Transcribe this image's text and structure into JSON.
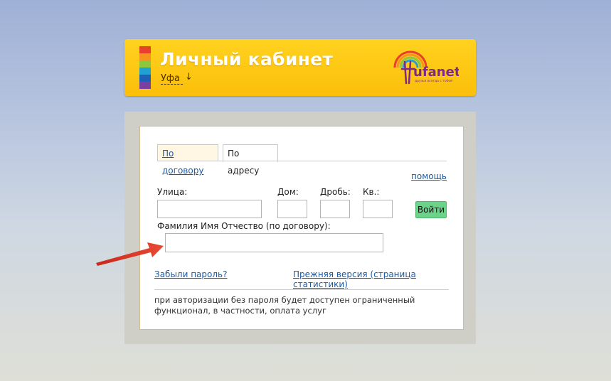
{
  "header": {
    "title": "Личный кабинет",
    "city": "Уфа",
    "city_icon": "arrow-down-icon",
    "logo_text": "ufanet",
    "logo_tagline": "друзья всегда с тобой",
    "stripe_colors": [
      "#e8402a",
      "#f7941d",
      "#8dc63f",
      "#21a0d2",
      "#1e5fb8",
      "#7b3fa0"
    ]
  },
  "tabs": [
    {
      "label": "По договору",
      "active": false
    },
    {
      "label": "По адресу",
      "active": true
    }
  ],
  "help_link": "помощь",
  "form": {
    "street_label": "Улица:",
    "house_label": "Дом:",
    "fraction_label": "Дробь:",
    "apartment_label": "Кв.:",
    "submit_label": "Войти",
    "name_label": "Фамилия Имя Отчество (по договору):",
    "street_value": "",
    "house_value": "",
    "fraction_value": "",
    "apartment_value": "",
    "name_value": ""
  },
  "links": {
    "forgot_password": "Забыли пароль?",
    "old_version": "Прежняя версия (страница статистики)"
  },
  "note": "при авторизации без пароля будет доступен ограниченный функционал, в частности, оплата услуг",
  "colors": {
    "header_yellow": "#fbbf0a",
    "link_blue": "#1b5aa6",
    "button_green": "#6cd38a",
    "annotation_red": "#e03a2a"
  }
}
